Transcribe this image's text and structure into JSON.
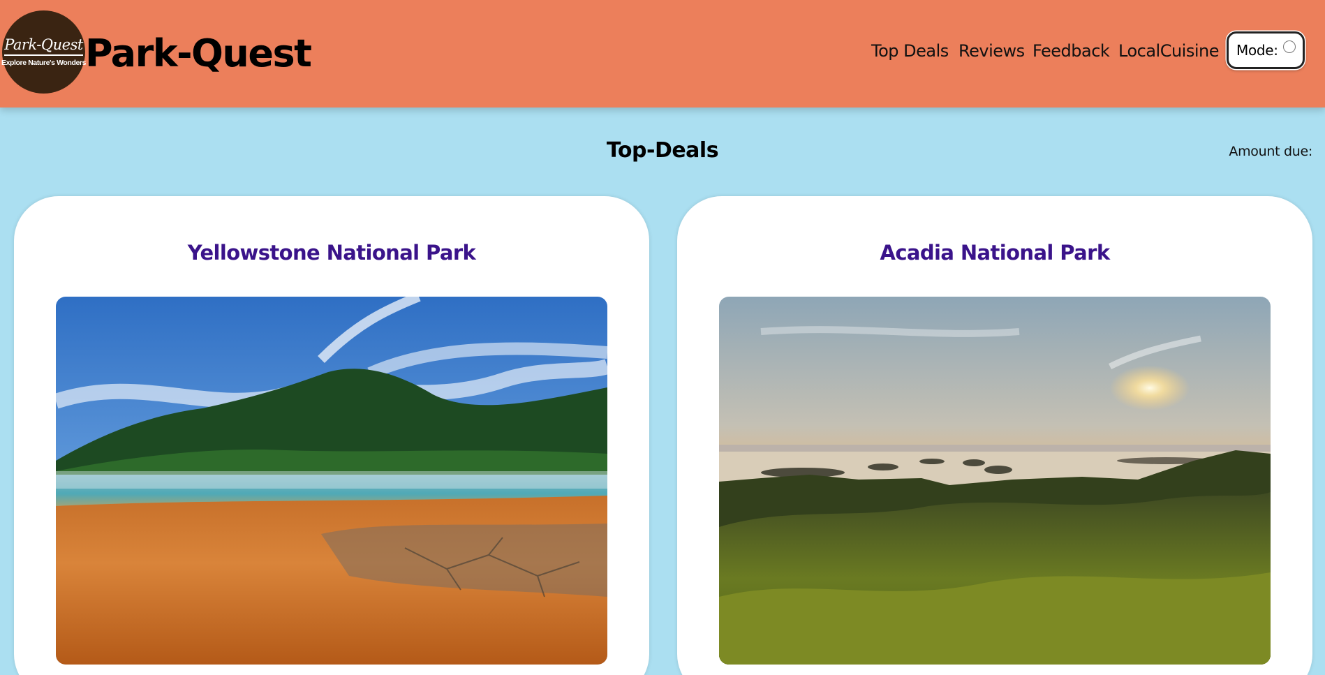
{
  "header": {
    "logo": {
      "title": "Park-Quest",
      "tagline": "Explore Nature's Wonders"
    },
    "brand_title": "Park-Quest",
    "nav": [
      {
        "label": "Top Deals"
      },
      {
        "label": "Reviews"
      },
      {
        "label": "Feedback"
      },
      {
        "label": "LocalCuisine"
      }
    ],
    "mode_label": "Mode:"
  },
  "main": {
    "section_title": "Top-Deals",
    "amount_due_label": "Amount due:",
    "cards": [
      {
        "title": "Yellowstone National Park",
        "image": "yellowstone-hot-spring-photo"
      },
      {
        "title": "Acadia National Park",
        "image": "acadia-sunset-photo"
      }
    ]
  },
  "colors": {
    "header_bg": "#ec7f5b",
    "page_bg": "#abdff1",
    "card_title": "#3a138a",
    "logo_bg": "#3a2412"
  }
}
